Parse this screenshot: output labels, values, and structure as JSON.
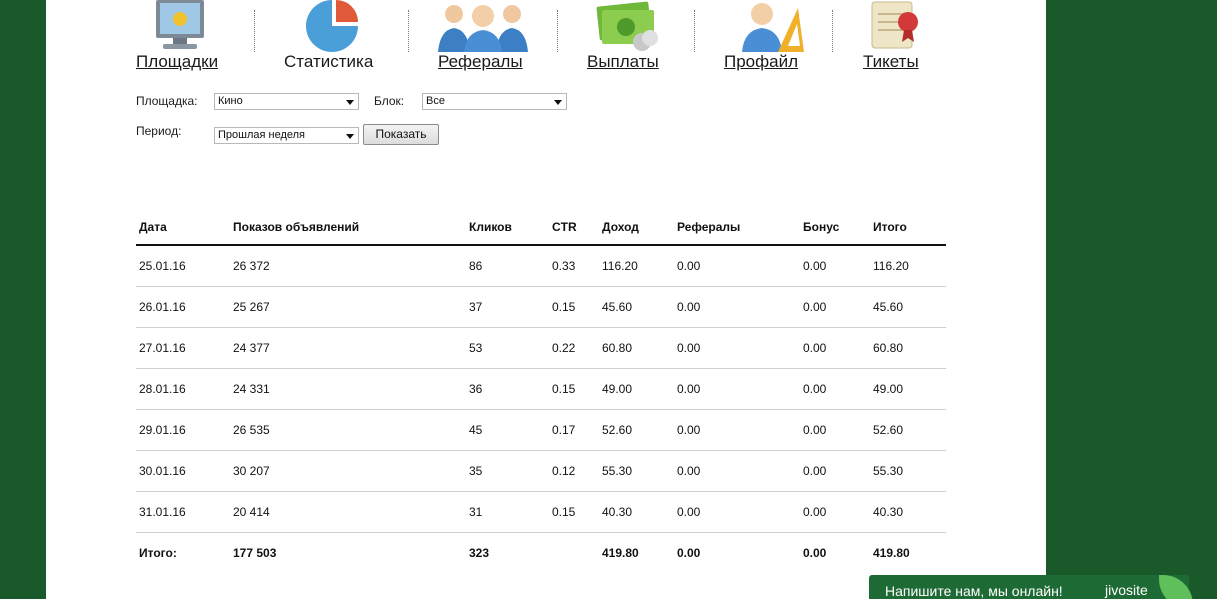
{
  "nav": {
    "items": [
      {
        "label": "Площадки",
        "icon": "monitor-icon",
        "link": true
      },
      {
        "label": "Статистика",
        "icon": "pie-chart-icon",
        "link": false
      },
      {
        "label": "Рефералы",
        "icon": "people-group-icon",
        "link": true
      },
      {
        "label": "Выплаты",
        "icon": "money-coins-icon",
        "link": true
      },
      {
        "label": "Профайл",
        "icon": "user-ruler-icon",
        "link": true
      },
      {
        "label": "Тикеты",
        "icon": "sealed-scroll-icon",
        "link": true
      }
    ]
  },
  "filters": {
    "site_label": "Площадка:",
    "site_value": "Кино",
    "block_label": "Блок:",
    "block_value": "Все",
    "period_label": "Период:",
    "period_value": "Прошлая неделя",
    "show_button": "Показать"
  },
  "table": {
    "headers": [
      "Дата",
      "Показов объявлений",
      "Кликов",
      "CTR",
      "Доход",
      "Рефералы",
      "Бонус",
      "Итого"
    ],
    "rows": [
      [
        "25.01.16",
        "26 372",
        "86",
        "0.33",
        "116.20",
        "0.00",
        "0.00",
        "116.20"
      ],
      [
        "26.01.16",
        "25 267",
        "37",
        "0.15",
        "45.60",
        "0.00",
        "0.00",
        "45.60"
      ],
      [
        "27.01.16",
        "24 377",
        "53",
        "0.22",
        "60.80",
        "0.00",
        "0.00",
        "60.80"
      ],
      [
        "28.01.16",
        "24 331",
        "36",
        "0.15",
        "49.00",
        "0.00",
        "0.00",
        "49.00"
      ],
      [
        "29.01.16",
        "26 535",
        "45",
        "0.17",
        "52.60",
        "0.00",
        "0.00",
        "52.60"
      ],
      [
        "30.01.16",
        "30 207",
        "35",
        "0.12",
        "55.30",
        "0.00",
        "0.00",
        "55.30"
      ],
      [
        "31.01.16",
        "20 414",
        "31",
        "0.15",
        "40.30",
        "0.00",
        "0.00",
        "40.30"
      ]
    ],
    "total": [
      "Итого:",
      "177 503",
      "323",
      "",
      "419.80",
      "0.00",
      "0.00",
      "419.80"
    ]
  },
  "chat": {
    "text": "Напишите нам, мы онлайн!",
    "brand": "jivosite"
  },
  "colors": {
    "background": "#1a5a2a",
    "chat": "#1e6a35"
  }
}
